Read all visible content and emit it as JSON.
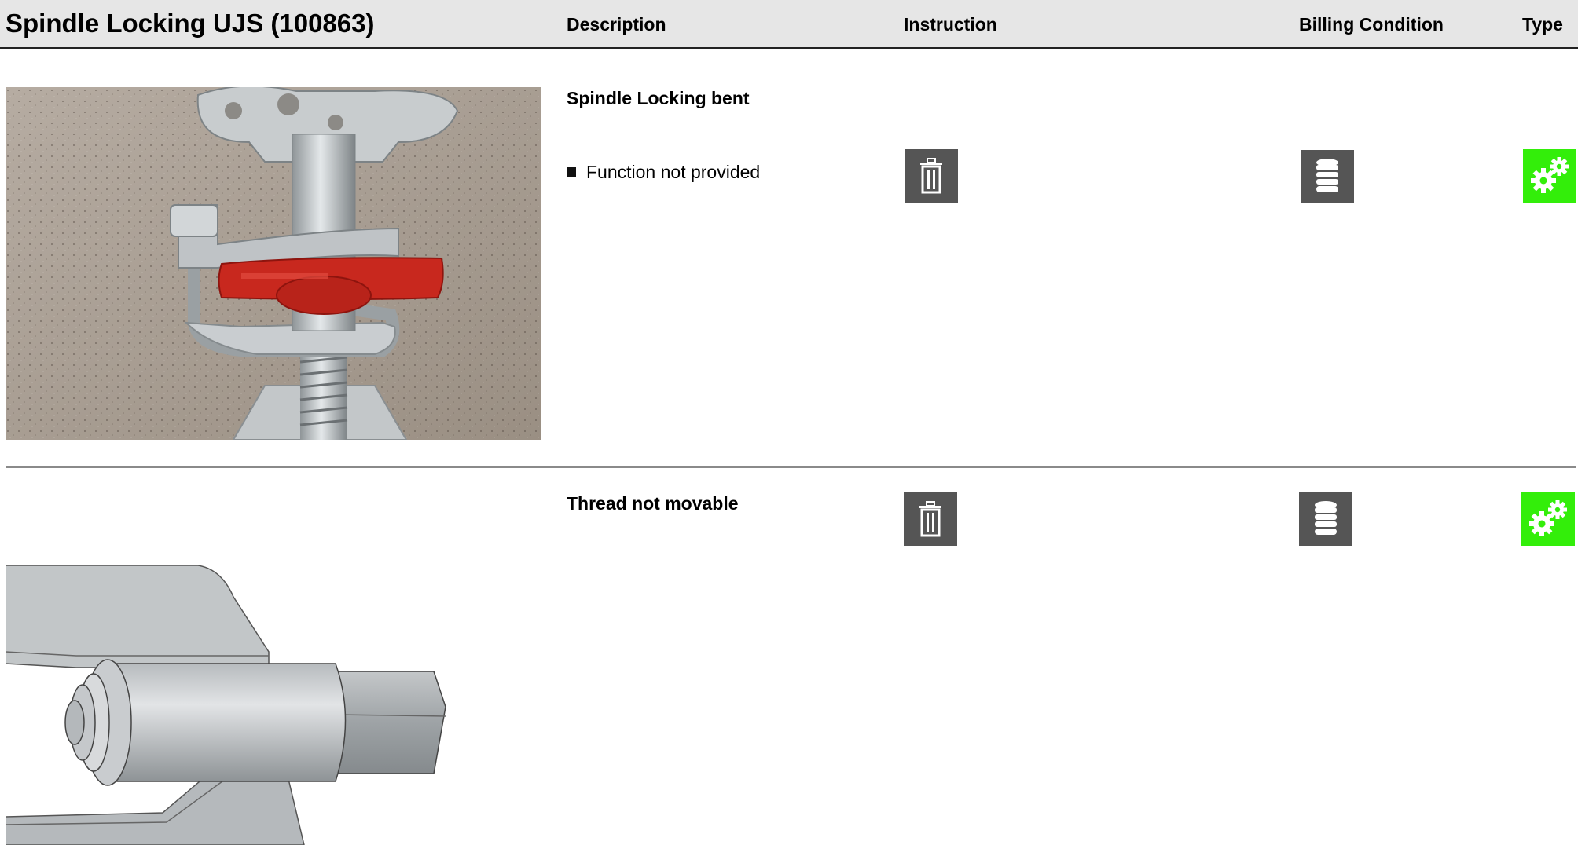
{
  "header": {
    "title": "Spindle Locking UJS (100863)",
    "columns": {
      "description": "Description",
      "instruction": "Instruction",
      "billing": "Billing Condition",
      "type": "Type"
    }
  },
  "rows": [
    {
      "title": "Spindle Locking bent",
      "items": [
        "Function not provided"
      ],
      "instruction_icon": "trash-icon",
      "billing_icon": "coin-stack-icon",
      "type_icon": "gears-icon"
    },
    {
      "title": "Thread not movable",
      "instruction_icon": "trash-icon",
      "billing_icon": "coin-stack-icon",
      "type_icon": "gears-icon"
    }
  ],
  "colors": {
    "header_bg": "#e6e6e6",
    "icon_dark": "#555555",
    "icon_green": "#33ee0a"
  }
}
